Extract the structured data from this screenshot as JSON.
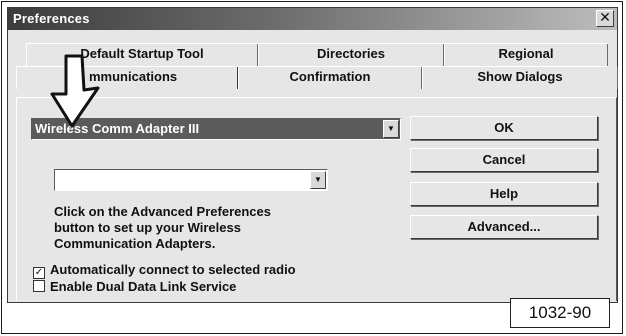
{
  "window": {
    "title": "Preferences",
    "close_glyph": "✕"
  },
  "tabs": {
    "back_row": [
      "Default Startup Tool",
      "Directories",
      "Regional"
    ],
    "front_row": [
      "Communications",
      "Confirmation",
      "Show Dialogs"
    ],
    "active": "Communications",
    "active_visible_text": "mmunications"
  },
  "comm": {
    "adapter_selected": "Wireless Comm Adapter III",
    "secondary_value": "",
    "help_lines": [
      "Click on the Advanced Preferences",
      "button to set up your Wireless",
      "Communication Adapters."
    ]
  },
  "buttons": {
    "ok": "OK",
    "cancel": "Cancel",
    "help": "Help",
    "advanced": "Advanced..."
  },
  "options": [
    {
      "label": "Automatically connect to selected radio",
      "checked": true,
      "mark": "✓"
    },
    {
      "label": "Enable Dual Data Link Service",
      "checked": false,
      "mark": ""
    }
  ],
  "figure_label": "1032-90",
  "icons": {
    "dropdown": "▼",
    "pointer": "callout-arrow-icon"
  }
}
